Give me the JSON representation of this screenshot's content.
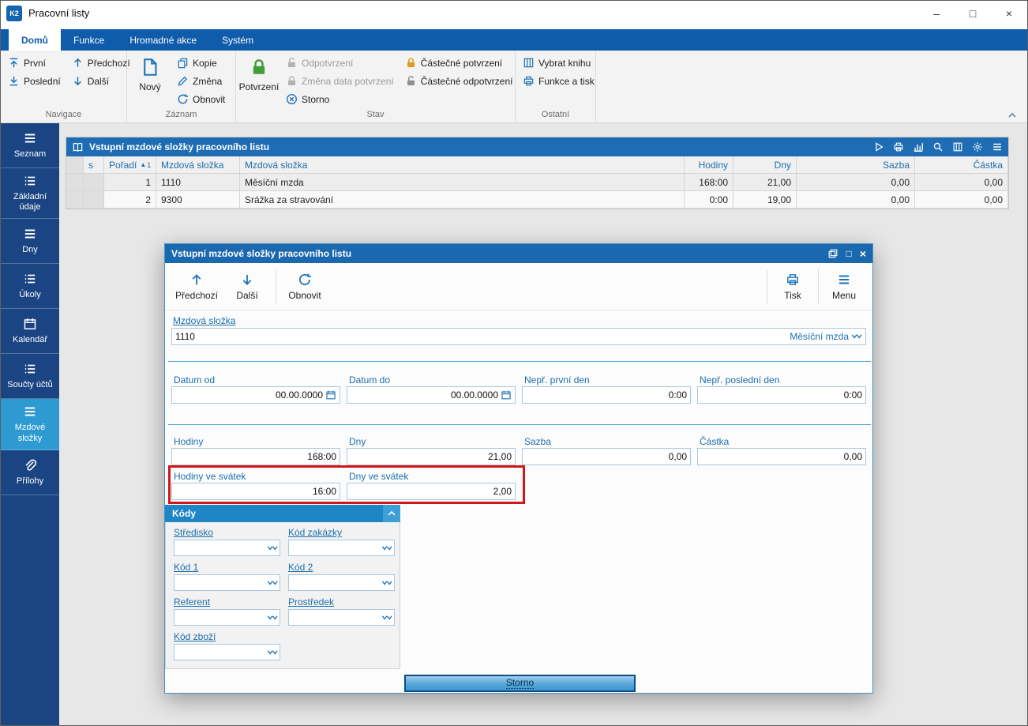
{
  "titlebar": {
    "logo": "K2",
    "title": "Pracovní listy"
  },
  "icons": {
    "minimize": "–",
    "maximize": "□",
    "close": "×",
    "sort_asc": "▲"
  },
  "colors": {
    "accent_blue": "#1e74b9",
    "header_blue": "#1e6db4",
    "tabbar_blue": "#0f5cab",
    "sidebar_navy": "#1b4483",
    "sidebar_active": "#2d9ad2",
    "highlight_red": "#d01818",
    "lock_green": "#3f9d3a",
    "lock_orange": "#e09c1f"
  },
  "tabs": [
    "Domů",
    "Funkce",
    "Hromadné akce",
    "Systém"
  ],
  "ribbon": {
    "prvni": "První",
    "posledni": "Poslední",
    "predchozi": "Předchozí",
    "dalsi": "Další",
    "novy": "Nový",
    "kopie": "Kopie",
    "zmena": "Změna",
    "obnovit": "Obnovit",
    "potvrzeni": "Potvrzení",
    "odpotvrzeni": "Odpotvrzení",
    "zmena_data": "Změna data potvrzení",
    "storno": "Storno",
    "castecne_potvrzeni": "Částečné potvrzení",
    "castecne_odpotvrzeni": "Částečné odpotvrzení",
    "vybrat_knihu": "Vybrat knihu",
    "funkce_tisk": "Funkce a tisk",
    "g_navigace": "Navigace",
    "g_zaznam": "Záznam",
    "g_stav": "Stav",
    "g_ostatni": "Ostatní"
  },
  "sidebar": {
    "items": [
      {
        "label": "Seznam"
      },
      {
        "label": "Základní údaje"
      },
      {
        "label": "Dny"
      },
      {
        "label": "Úkoly"
      },
      {
        "label": "Kalendář"
      },
      {
        "label": "Součty účtů"
      },
      {
        "label": "Mzdové složky"
      },
      {
        "label": "Přílohy"
      }
    ]
  },
  "grid": {
    "title": "Vstupní mzdové složky pracovního listu",
    "columns": [
      "s",
      "Pořadí",
      "Mzdová složka",
      "Mzdová složka",
      "Hodiny",
      "Dny",
      "Sazba",
      "Částka"
    ],
    "sort_order": "1",
    "rows": [
      {
        "poradi": "1",
        "kod": "1110",
        "nazev": "Měsíční mzda",
        "hodiny": "168:00",
        "dny": "21,00",
        "sazba": "0,00",
        "castka": "0,00"
      },
      {
        "poradi": "2",
        "kod": "9300",
        "nazev": "Srážka za stravování",
        "hodiny": "0:00",
        "dny": "19,00",
        "sazba": "0,00",
        "castka": "0,00"
      }
    ]
  },
  "dialog": {
    "title": "Vstupní mzdové složky pracovního listu",
    "toolbar": {
      "predchozi": "Předchozí",
      "dalsi": "Další",
      "obnovit": "Obnovit",
      "tisk": "Tisk",
      "menu": "Menu"
    },
    "fields": {
      "mzdova_slozka_label": "Mzdová složka",
      "mzdova_slozka_value": "1110",
      "mzdova_slozka_name": "Měsíční mzda",
      "datum_od_label": "Datum od",
      "datum_od_value": "00.00.0000",
      "datum_do_label": "Datum do",
      "datum_do_value": "00.00.0000",
      "nepr_prvni_label": "Nepř. první den",
      "nepr_prvni_value": "0:00",
      "nepr_posledni_label": "Nepř. poslední den",
      "nepr_posledni_value": "0:00",
      "hodiny_label": "Hodiny",
      "hodiny_value": "168:00",
      "dny_label": "Dny",
      "dny_value": "21,00",
      "sazba_label": "Sazba",
      "sazba_value": "0,00",
      "castka_label": "Částka",
      "castka_value": "0,00",
      "hodiny_svatek_label": "Hodiny ve svátek",
      "hodiny_svatek_value": "16:00",
      "dny_svatek_label": "Dny ve svátek",
      "dny_svatek_value": "2,00"
    },
    "kody": {
      "title": "Kódy",
      "stredisko": "Středisko",
      "kod_zakazky": "Kód zakázky",
      "kod1": "Kód 1",
      "kod2": "Kód 2",
      "referent": "Referent",
      "prostredek": "Prostředek",
      "kod_zbozi": "Kód zboží"
    },
    "storno": "Storno"
  }
}
